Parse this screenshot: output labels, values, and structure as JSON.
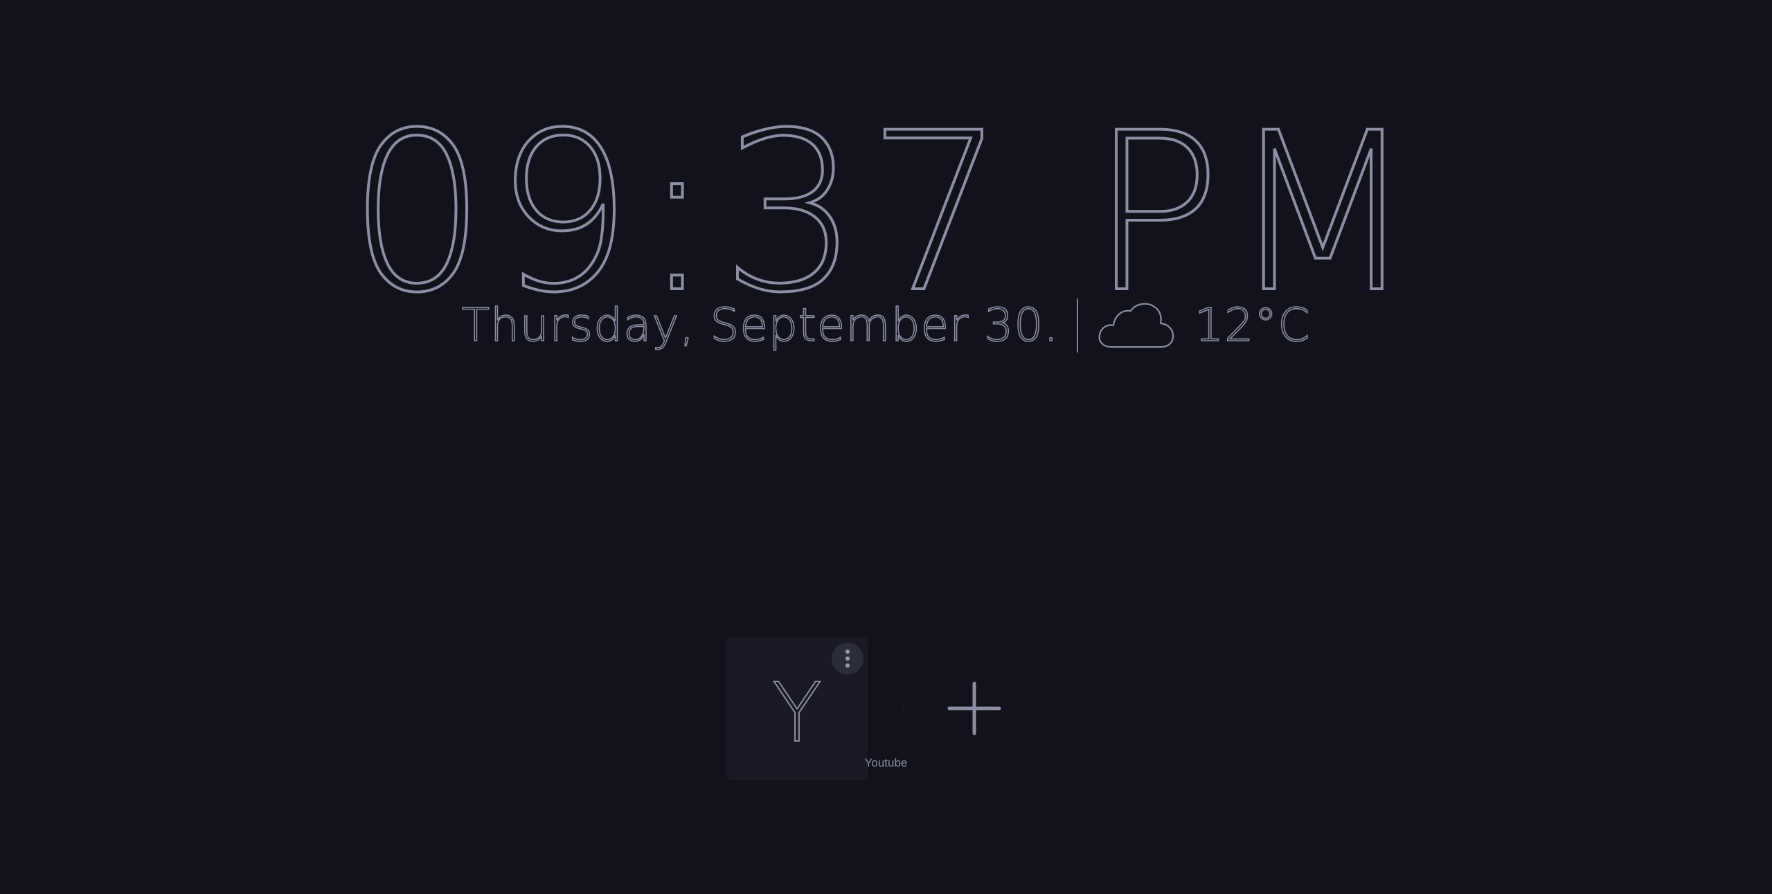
{
  "clock": {
    "time": "09:37 PM"
  },
  "date": {
    "text": "Thursday, September 30."
  },
  "weather": {
    "condition_icon": "cloud-icon",
    "temperature": "12°C"
  },
  "shortcuts": [
    {
      "letter": "Y",
      "label": "Youtube",
      "menu_icon": "more-vertical-icon"
    }
  ],
  "add_shortcut": {
    "icon": "plus-icon"
  },
  "colors": {
    "background": "#12121c",
    "foreground": "#8c8fa3",
    "tile": "#1a1a26"
  }
}
